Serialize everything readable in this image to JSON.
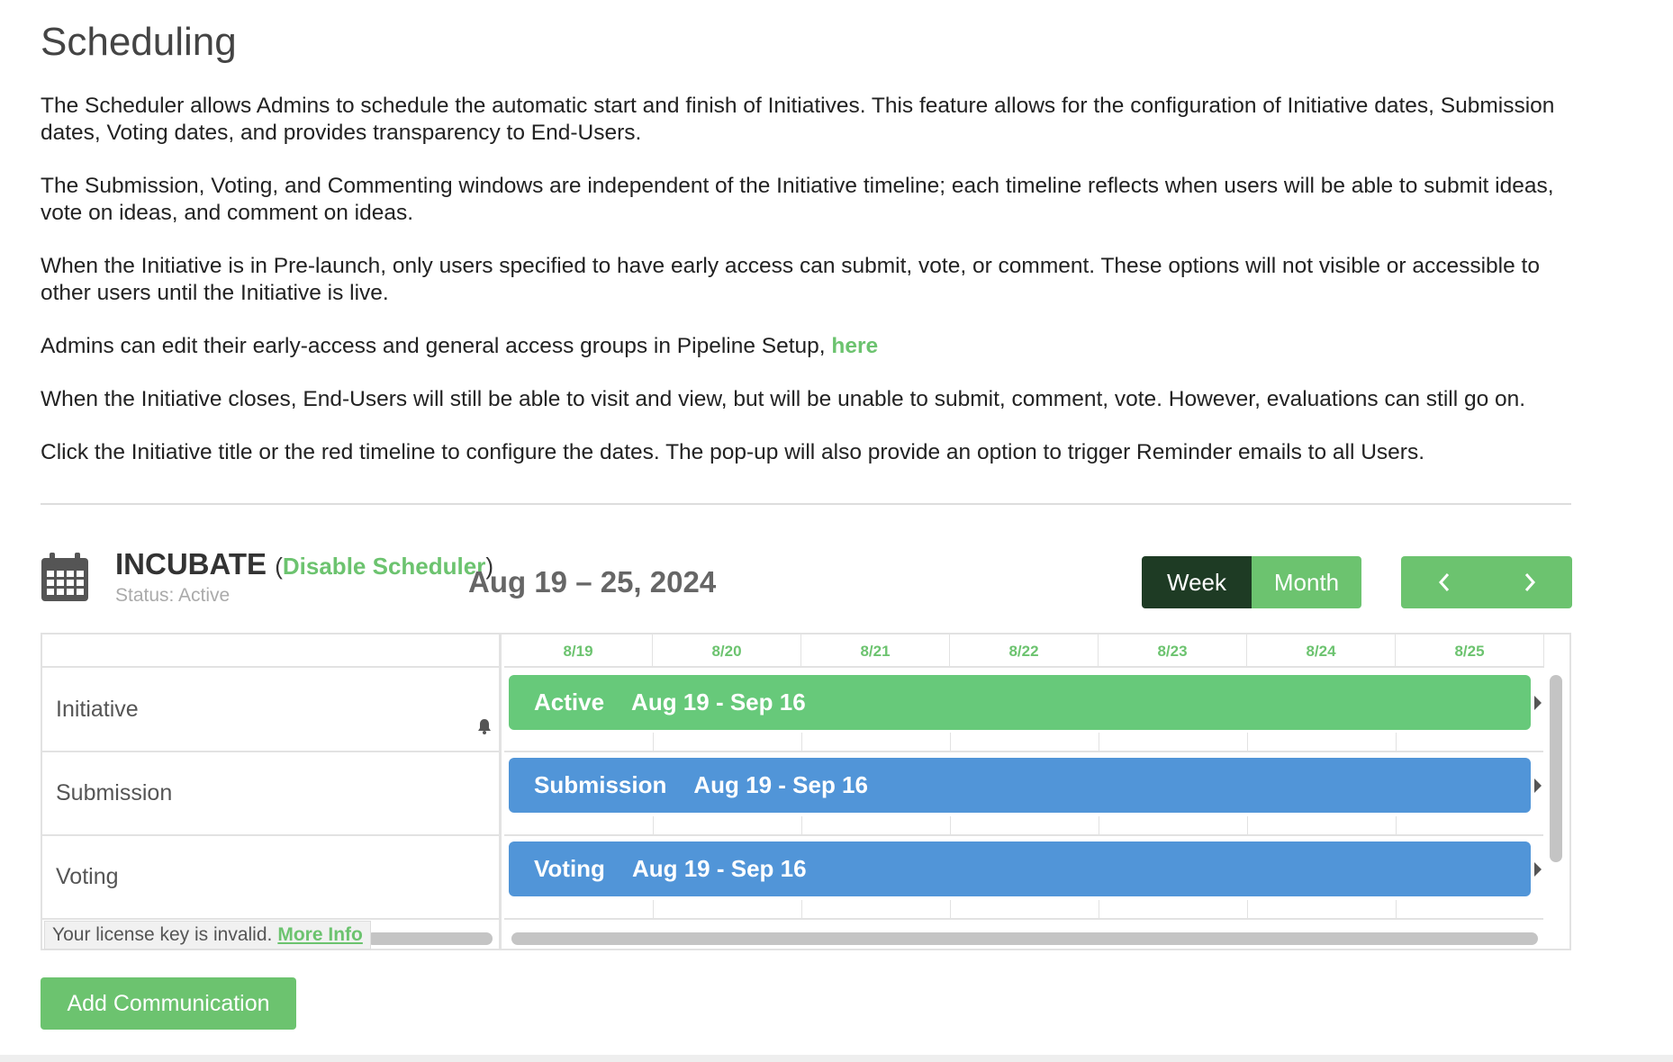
{
  "page": {
    "title": "Scheduling",
    "paragraphs": [
      "The Scheduler allows Admins to schedule the automatic start and finish of Initiatives. This feature allows for the configuration of Initiative dates, Submission dates, Voting dates, and provides transparency to End-Users.",
      "The Submission, Voting, and Commenting windows are independent of the Initiative timeline; each timeline reflects when users will be able to submit ideas, vote on ideas, and comment on ideas.",
      "When the Initiative is in Pre-launch, only users specified to have early access can submit, vote, or comment. These options will not visible or accessible to other users until the Initiative is live.",
      "Admins can edit their early-access and general access groups in Pipeline Setup, ",
      "When the Initiative closes, End-Users will still be able to visit and view, but will be unable to submit, comment, vote. However, evaluations can still go on.",
      "Click the Initiative title or the red timeline to configure the dates. The pop-up will also provide an option to trigger Reminder emails to all Users."
    ],
    "here_link": "here"
  },
  "scheduler": {
    "name": "INCUBATE",
    "paren_open": "(",
    "paren_close": ")",
    "disable_link": "Disable Scheduler",
    "status": "Status: Active",
    "date_range": "Aug 19 – 25, 2024",
    "views": {
      "week": "Week",
      "month": "Month"
    },
    "days": [
      "8/19",
      "8/20",
      "8/21",
      "8/22",
      "8/23",
      "8/24",
      "8/25"
    ],
    "rows": [
      {
        "label": "Initiative",
        "bar_label": "Active",
        "bar_dates": "Aug 19 - Sep 16",
        "color": "#67c97a"
      },
      {
        "label": "Submission",
        "bar_label": "Submission",
        "bar_dates": "Aug 19 - Sep 16",
        "color": "#5195d8"
      },
      {
        "label": "Voting",
        "bar_label": "Voting",
        "bar_dates": "Aug 19 - Sep 16",
        "color": "#5195d8"
      }
    ],
    "license_text": "Your license key is invalid.",
    "license_link": "More Info"
  },
  "actions": {
    "add_communication": "Add Communication"
  },
  "colors": {
    "accent_green": "#6cc36f",
    "active_toggle": "#1e3b24",
    "initiative_bar": "#67c97a",
    "window_bar": "#5195d8"
  }
}
